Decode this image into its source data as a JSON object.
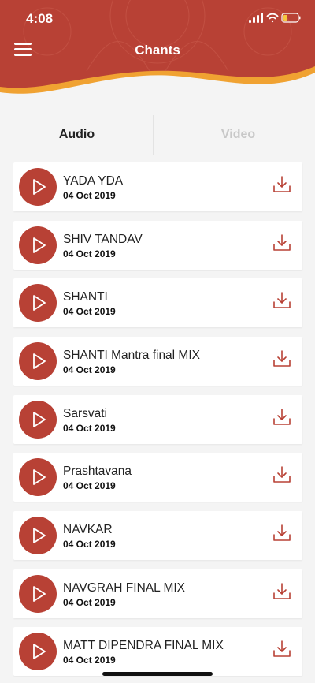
{
  "status_bar": {
    "time": "4:08"
  },
  "header": {
    "title": "Chants"
  },
  "tabs": [
    {
      "label": "Audio",
      "active": true
    },
    {
      "label": "Video",
      "active": false
    }
  ],
  "colors": {
    "header": "#b84135",
    "accent_wave": "#f0a232",
    "play": "#b84135"
  },
  "items": [
    {
      "title": "YADA YDA",
      "date": "04 Oct 2019"
    },
    {
      "title": "SHIV TANDAV",
      "date": "04 Oct 2019"
    },
    {
      "title": "SHANTI",
      "date": "04 Oct 2019"
    },
    {
      "title": "SHANTI Mantra final MIX",
      "date": "04 Oct 2019"
    },
    {
      "title": "Sarsvati",
      "date": "04 Oct 2019"
    },
    {
      "title": "Prashtavana",
      "date": "04 Oct 2019"
    },
    {
      "title": "NAVKAR",
      "date": "04 Oct 2019"
    },
    {
      "title": "NAVGRAH FINAL MIX",
      "date": "04 Oct 2019"
    },
    {
      "title": "MATT DIPENDRA FINAL MIX",
      "date": "04 Oct 2019"
    }
  ]
}
